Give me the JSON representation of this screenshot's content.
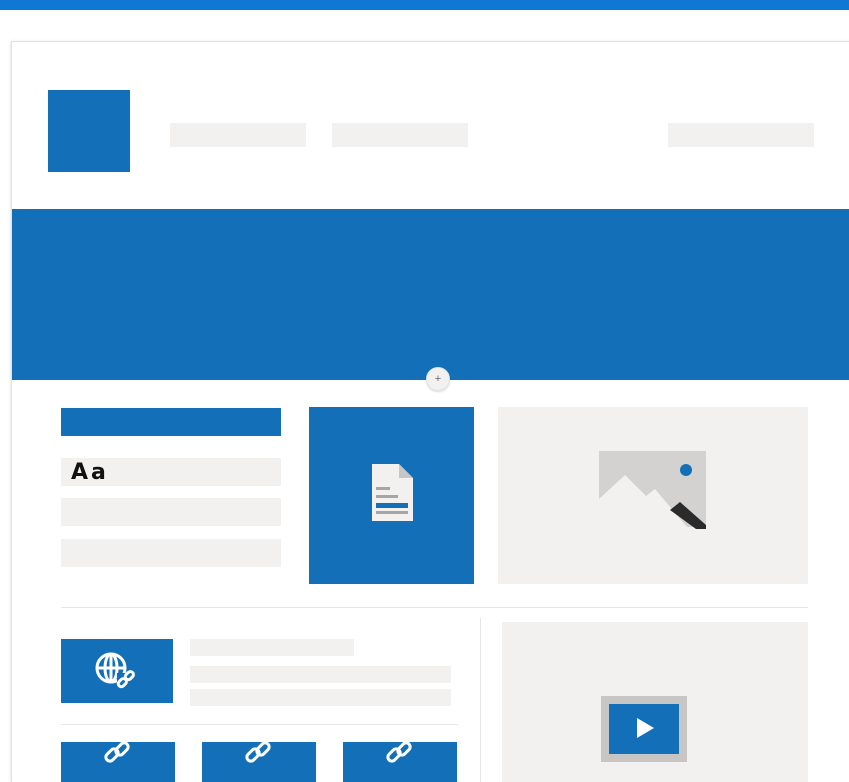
{
  "colors": {
    "topbar": "#0f78d4",
    "accent_blue": "#1370b8",
    "placeholder_gray": "#f2f1f0"
  },
  "add_section": {
    "label": "+"
  },
  "text_sample": {
    "label": "Aa"
  },
  "icons": {
    "document": "document-icon",
    "image": "image-icon",
    "globe_link": "globe-link-icon",
    "link": "link-icon",
    "video": "video-play-icon"
  }
}
